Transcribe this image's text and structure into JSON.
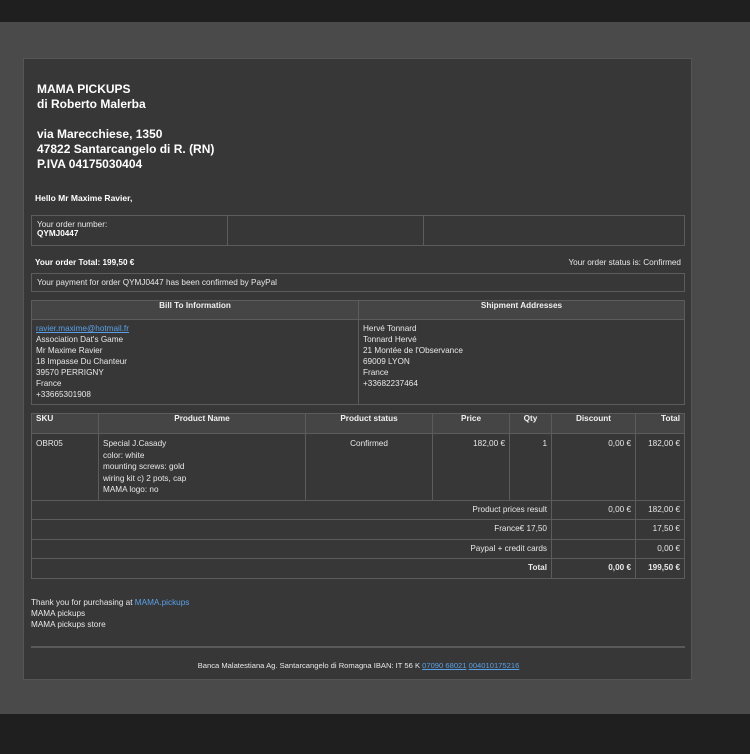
{
  "company": {
    "name": "MAMA PICKUPS",
    "owner": "di Roberto Malerba",
    "street": "via Marecchiese, 1350",
    "city": "47822 Santarcangelo di R. (RN)",
    "vat": "P.IVA 04175030404"
  },
  "greeting": "Hello Mr Maxime Ravier,",
  "order": {
    "number_label": "Your order number:",
    "number": "QYMJ0447",
    "total_label": "Your order Total: 199,50 €",
    "status_label": "Your order status is: Confirmed",
    "payment_note": "Your payment for order QYMJ0447 has been confirmed by PayPal"
  },
  "billing": {
    "header": "Bill To Information",
    "email": "ravier.maxime@hotmail.fr",
    "lines": [
      "Association Dat's Game",
      "Mr Maxime Ravier",
      "18 Impasse Du Chanteur",
      "39570 PERRIGNY",
      "France",
      "+33665301908"
    ]
  },
  "shipping": {
    "header": "Shipment Addresses",
    "lines": [
      "Hervé Tonnard",
      "Tonnard Hervé",
      "21 Montée de l'Observance",
      "69009 LYON",
      "France",
      "+33682237464"
    ]
  },
  "products": {
    "headers": {
      "sku": "SKU",
      "name": "Product Name",
      "status": "Product status",
      "price": "Price",
      "qty": "Qty",
      "discount": "Discount",
      "total": "Total"
    },
    "items": [
      {
        "sku": "OBR05",
        "name_lines": [
          "Special J.Casady",
          "color: white",
          "mounting screws: gold",
          "wiring kit c) 2 pots, cap",
          "MAMA logo: no"
        ],
        "status": "Confirmed",
        "price": "182,00 €",
        "qty": "1",
        "discount": "0,00 €",
        "total": "182,00 €"
      }
    ],
    "summary": {
      "product_prices_label": "Product prices result",
      "product_prices_discount": "0,00 €",
      "product_prices_total": "182,00 €",
      "shipping_label": "France€ 17,50",
      "shipping_total": "17,50 €",
      "payment_label": "Paypal + credit cards",
      "payment_total": "0,00 €",
      "total_label": "Total",
      "total_discount": "0,00 €",
      "total_total": "199,50 €"
    }
  },
  "footer": {
    "thanks_prefix": "Thank you for purchasing at ",
    "thanks_link": "MAMA.pickups",
    "line2": "MAMA pickups",
    "line3": "MAMA pickups store",
    "bank_prefix": "Banca Malatestiana Ag. Santarcangelo di Romagna IBAN: IT 56 K ",
    "bank_link1": "07090 68021",
    "bank_link2": "004010175216"
  },
  "colors": {
    "background": "#4a4a4a",
    "mail_bg": "#373737",
    "link": "#5aa0e8"
  }
}
